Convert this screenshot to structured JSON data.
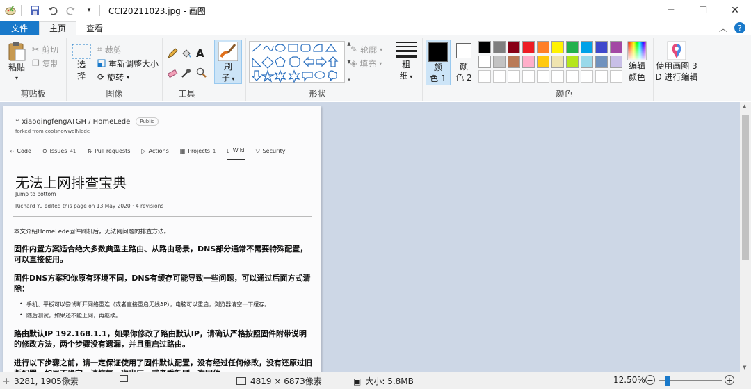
{
  "titlebar": {
    "title": "CCI20211023.jpg - 画图",
    "qa_icons": [
      "paint-app-icon",
      "save-icon",
      "undo-icon",
      "redo-icon",
      "customize-dropdown-icon"
    ],
    "minimize": "─",
    "maximize": "☐",
    "close": "✕"
  },
  "tabs": {
    "file": "文件",
    "home": "主页",
    "view": "查看",
    "collapse": "︿",
    "help": "?"
  },
  "ribbon": {
    "clipboard": {
      "label": "剪贴板",
      "paste": "粘贴",
      "cut": "剪切",
      "copy": "复制"
    },
    "image": {
      "label": "图像",
      "select_l1": "选",
      "select_l2": "择",
      "crop": "裁剪",
      "resize": "重新调整大小",
      "rotate": "旋转"
    },
    "tools": {
      "label": "工具"
    },
    "brushes": {
      "line1": "刷",
      "line2": "子"
    },
    "shapes": {
      "label": "形状",
      "outline": "轮廓",
      "fill": "填充"
    },
    "size": {
      "line1": "粗",
      "line2": "细"
    },
    "color1": {
      "line1": "颜",
      "line2": "色 1"
    },
    "color2": {
      "line1": "颜",
      "line2": "色 2"
    },
    "colors": {
      "label": "颜色",
      "row1": [
        "#000000",
        "#7f7f7f",
        "#880015",
        "#ed1c24",
        "#ff7f27",
        "#fff200",
        "#22b14c",
        "#00a2e8",
        "#3f48cc",
        "#a349a4"
      ],
      "row2": [
        "#ffffff",
        "#c3c3c3",
        "#b97a57",
        "#ffaec9",
        "#ffc90e",
        "#efe4b0",
        "#b5e61d",
        "#99d9ea",
        "#7092be",
        "#c8bfe7"
      ],
      "color1_value": "#000000",
      "color2_value": "#ffffff"
    },
    "edit_colors": {
      "line1": "编辑",
      "line2": "颜色"
    },
    "paint3d": {
      "line1": "使用画图 3",
      "line2": "D 进行编辑"
    }
  },
  "document": {
    "repo": "xiaoqingfengATGH / HomeLede",
    "badge": "Public",
    "forked": "forked from coolsnowwolf/lede",
    "tabs": [
      {
        "label": "Code",
        "count": ""
      },
      {
        "label": "Issues",
        "count": "41"
      },
      {
        "label": "Pull requests",
        "count": ""
      },
      {
        "label": "Actions",
        "count": ""
      },
      {
        "label": "Projects",
        "count": "1"
      },
      {
        "label": "Wiki",
        "count": ""
      },
      {
        "label": "Security",
        "count": ""
      }
    ],
    "title": "无法上网排查宝典",
    "jump": "Jump to bottom",
    "edited": "Richard Yu edited this page on 13 May 2020 · 4 revisions",
    "intro": "本文介绍HomeLede固件刷机后，无法网问题的排查方法。",
    "h_a": "固件内置方案适合绝大多数典型主路由、从路由场景，DNS部分通常不需要特殊配置，可以直接使用。",
    "h_b": "固件DNS方案和你原有环境不同，DNS有缓存可能导致一些问题，可以通过后面方式清除：",
    "li_1": "手机、平板可以尝试断开网络重连（或者直接重启无线AP），电脑可以重启，浏览器清空一下缓存。",
    "li_2": "随后测试，如果还不能上网，再继续。",
    "h_c": "路由默认IP 192.168.1.1，如果你修改了路由默认IP，请确认严格按照固件附带说明的修改方法，两个步骤没有遗漏，并且重启过路由。",
    "h_d": "进行以下步骤之前，请一定保证使用了固件默认配置，没有经过任何修改，没有还原过旧版配置，如果不确定，请恢复一次出厂，或者重新刷一次固件"
  },
  "statusbar": {
    "cursor_pos": "3281, 1905像素",
    "dimensions": "4819 × 6873像素",
    "size": "大小: 5.8MB",
    "zoom": "12.50%",
    "zoom_out": "−",
    "zoom_in": "+",
    "zoom_fraction": 0.1
  }
}
